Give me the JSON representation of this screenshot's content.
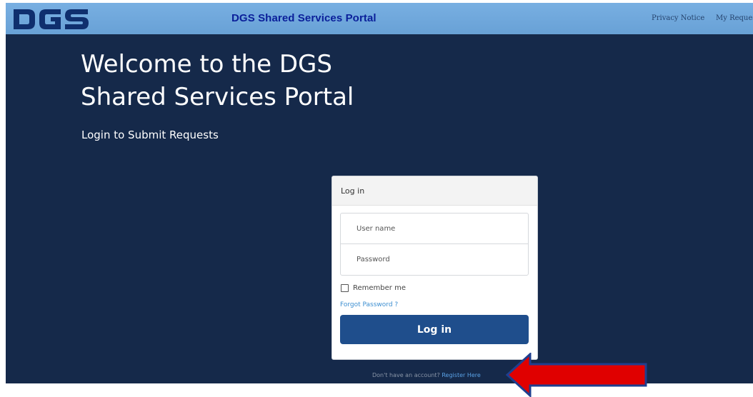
{
  "header": {
    "logo_text": "DGS",
    "portal_title": "DGS Shared Services Portal",
    "nav": {
      "privacy": "Privacy Notice",
      "my_requests": "My Requests"
    }
  },
  "hero": {
    "welcome_line1": "Welcome to the DGS",
    "welcome_line2": "Shared Services Portal",
    "subtitle": "Login to Submit Requests"
  },
  "login_card": {
    "title": "Log in",
    "username_placeholder": "User name",
    "password_placeholder": "Password",
    "remember_label": "Remember me",
    "remember_checked": false,
    "forgot_link": "Forgot Password ?",
    "submit_label": "Log in"
  },
  "register": {
    "prompt": "Don't have an account?",
    "link": "Register Here"
  },
  "annotation": {
    "icon": "red-arrow-icon",
    "color": "#e00000"
  },
  "colors": {
    "header_bg": "#6fa8dc",
    "hero_bg": "#15294a",
    "title_blue": "#0a1f9a",
    "button_bg": "#1f4e8c",
    "link_blue": "#3d8fd1"
  }
}
